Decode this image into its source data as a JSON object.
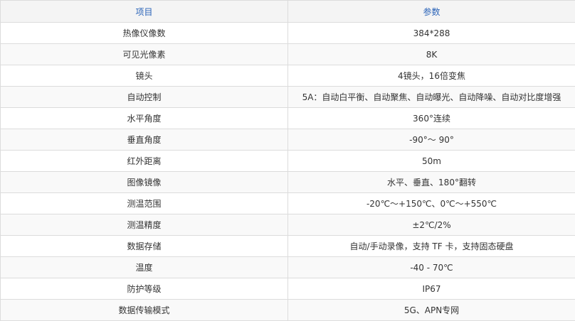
{
  "table": {
    "headers": [
      "项目",
      "参数"
    ],
    "rows": [
      [
        "热像仪像数",
        "384*288"
      ],
      [
        "可见光像素",
        "8K"
      ],
      [
        "镜头",
        "4镜头，16倍变焦"
      ],
      [
        "自动控制",
        "5A：自动白平衡、自动聚焦、自动曝光、自动降噪、自动对比度增强"
      ],
      [
        "水平角度",
        "360°连续"
      ],
      [
        "垂直角度",
        "-90°～ 90°"
      ],
      [
        "红外距离",
        "50m"
      ],
      [
        "图像镜像",
        "水平、垂直、180°翻转"
      ],
      [
        "测温范围",
        "-20℃～+150℃、0℃～+550℃"
      ],
      [
        "测温精度",
        "±2℃/2%"
      ],
      [
        "数据存储",
        "自动/手动录像，支持 TF 卡，支持固态硬盘"
      ],
      [
        "温度",
        "-40 - 70℃"
      ],
      [
        "防护等级",
        "IP67"
      ],
      [
        "数据传输模式",
        "5G、APN专网"
      ]
    ]
  }
}
